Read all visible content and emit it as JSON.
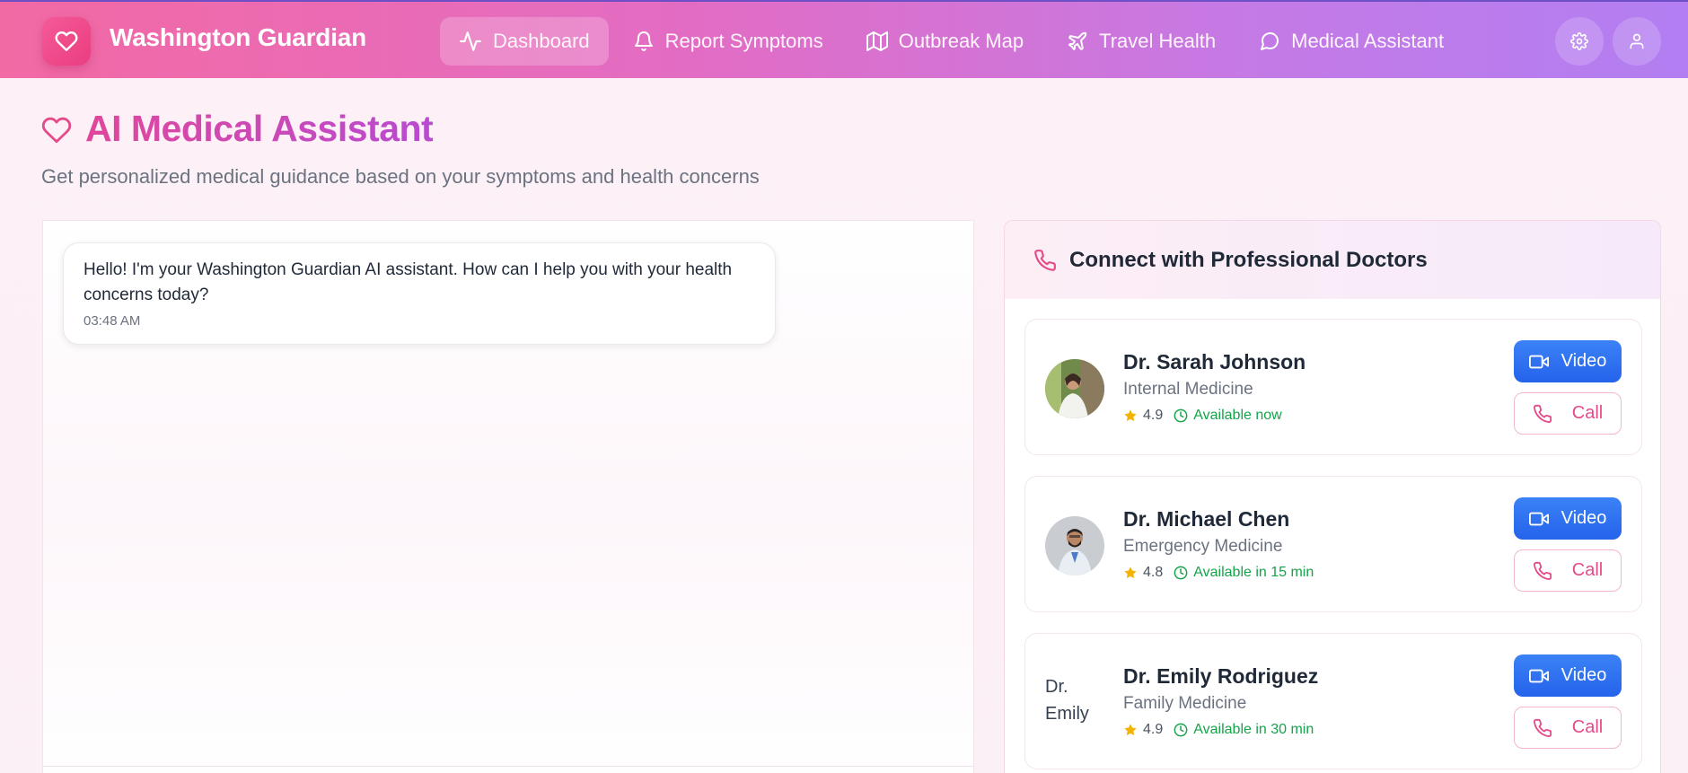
{
  "app": {
    "brand": "Washington Guardian"
  },
  "nav": {
    "items": [
      {
        "label": "Dashboard",
        "icon": "activity-icon",
        "active": true
      },
      {
        "label": "Report Symptoms",
        "icon": "bell-icon",
        "active": false
      },
      {
        "label": "Outbreak Map",
        "icon": "map-icon",
        "active": false
      },
      {
        "label": "Travel Health",
        "icon": "plane-icon",
        "active": false
      },
      {
        "label": "Medical Assistant",
        "icon": "message-circle-icon",
        "active": false
      }
    ],
    "settings_icon": "gear-icon",
    "user_icon": "user-icon"
  },
  "page": {
    "title": "AI Medical Assistant",
    "subtitle": "Get personalized medical guidance based on your symptoms and health concerns"
  },
  "chat": {
    "messages": [
      {
        "text": "Hello! I'm your Washington Guardian AI assistant. How can I help you with your health concerns today?",
        "time": "03:48 AM"
      }
    ]
  },
  "doctors": {
    "title": "Connect with Professional Doctors",
    "video_label": "Video",
    "call_label": "Call",
    "list": [
      {
        "name": "Dr. Sarah Johnson",
        "specialty": "Internal Medicine",
        "rating": "4.9",
        "availability": "Available now"
      },
      {
        "name": "Dr. Michael Chen",
        "specialty": "Emergency Medicine",
        "rating": "4.8",
        "availability": "Available in 15 min"
      },
      {
        "name": "Dr. Emily Rodriguez",
        "specialty": "Family Medicine",
        "rating": "4.9",
        "availability": "Available in 30 min",
        "avatar_alt": "Dr. Emily"
      }
    ]
  },
  "colors": {
    "accent_pink": "#e44b8a",
    "accent_purple": "#b94ad2",
    "video_blue": "#2563eb",
    "available_green": "#16a34a",
    "star_yellow": "#f5b301"
  }
}
